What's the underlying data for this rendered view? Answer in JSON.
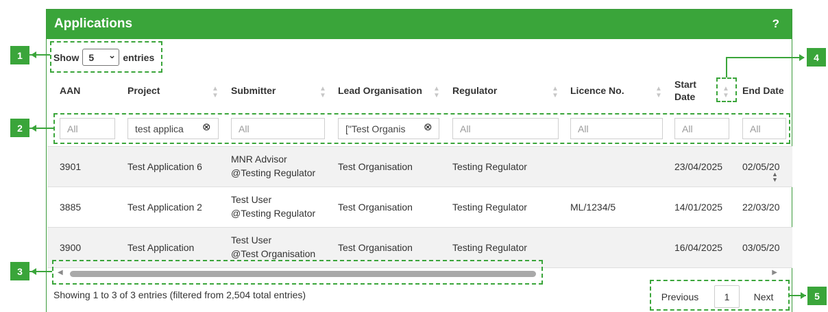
{
  "panel": {
    "title": "Applications",
    "help": "?"
  },
  "length": {
    "show": "Show",
    "value": "5",
    "entries": "entries"
  },
  "columns": [
    "AAN",
    "Project",
    "Submitter",
    "Lead Organisation",
    "Regulator",
    "Licence No.",
    "Start\nDate",
    "End Date"
  ],
  "filters": {
    "aan": "All",
    "project": "test applica",
    "submitter": "All",
    "lead_org": "[\"Test Organis",
    "regulator": "All",
    "licence": "All",
    "start": "All",
    "end": "All"
  },
  "rows": [
    {
      "aan": "3901",
      "project": "Test Application 6",
      "submitter_1": "MNR Advisor",
      "submitter_2": "@Testing Regulator",
      "lead_org": "Test Organisation",
      "regulator": "Testing Regulator",
      "licence": "",
      "start": "23/04/2025",
      "end": "02/05/20"
    },
    {
      "aan": "3885",
      "project": "Test Application 2",
      "submitter_1": "Test User",
      "submitter_2": "@Testing Regulator",
      "lead_org": "Test Organisation",
      "regulator": "Testing Regulator",
      "licence": "ML/1234/5",
      "start": "14/01/2025",
      "end": "22/03/20"
    },
    {
      "aan": "3900",
      "project": "Test Application",
      "submitter_1": "Test User",
      "submitter_2": "@Test Organisation",
      "lead_org": "Test Organisation",
      "regulator": "Testing Regulator",
      "licence": "",
      "start": "16/04/2025",
      "end": "03/05/20"
    }
  ],
  "info": "Showing 1 to 3 of 3 entries (filtered from 2,504 total entries)",
  "pagination": {
    "previous": "Previous",
    "page": "1",
    "next": "Next"
  },
  "callouts": [
    "1",
    "2",
    "3",
    "4",
    "5"
  ],
  "colors": {
    "brand_green": "#3aa53a",
    "row_shade": "#f2f2f2"
  }
}
